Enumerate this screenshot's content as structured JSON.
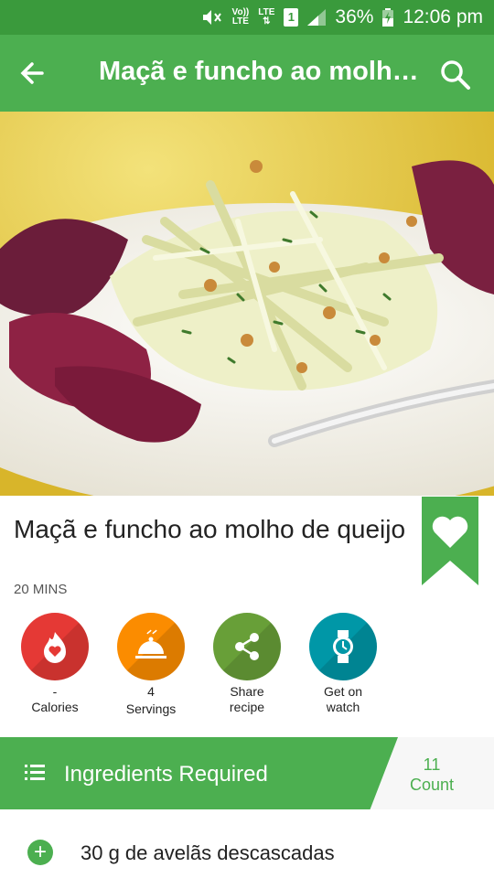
{
  "status_bar": {
    "volte": "Vo))",
    "volte_sub": "LTE",
    "lte": "LTE",
    "sim": "1",
    "battery": "36%",
    "time": "12:06 pm"
  },
  "app_bar": {
    "title": "Maçã e funcho ao molh…",
    "back_icon": "arrow-back-icon",
    "search_icon": "search-icon"
  },
  "hero": {
    "description": ""
  },
  "recipe": {
    "title": "Maçã e funcho ao molho de queijo",
    "time": "20 MINS",
    "bookmarked": true
  },
  "actions": [
    {
      "icon": "calories-icon",
      "value": "-",
      "label": "Calories",
      "color": "#e53935"
    },
    {
      "icon": "servings-icon",
      "value": "4",
      "label": "Servings",
      "color": "#fb8c00"
    },
    {
      "icon": "share-icon",
      "value": "Share",
      "label": "recipe",
      "color": "#689f38"
    },
    {
      "icon": "watch-icon",
      "value": "Get on",
      "label": "watch",
      "color": "#0097a7"
    }
  ],
  "ingredients": {
    "header": "Ingredients Required",
    "count_value": "11",
    "count_label": "Count",
    "items": [
      {
        "text": "30 g de avelãs descascadas"
      }
    ]
  },
  "colors": {
    "primary": "#4caf50",
    "status": "#3a9a3c"
  }
}
